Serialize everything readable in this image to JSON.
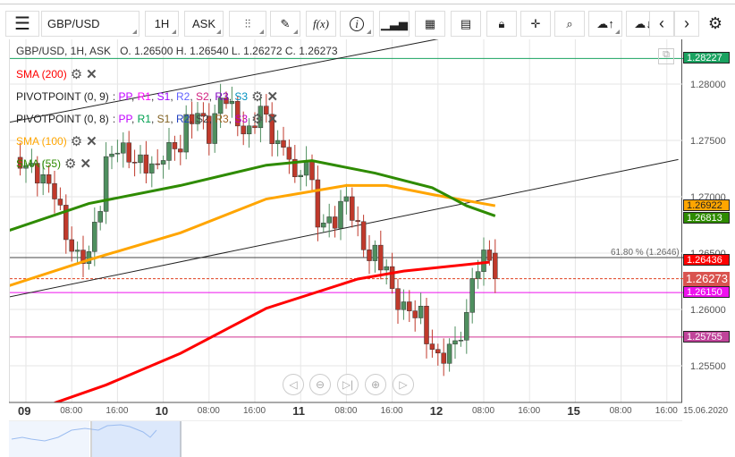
{
  "toolbar": {
    "symbol": "GBP/USD",
    "timeframe": "1H",
    "price_type": "ASK",
    "fx_label": "f(x)"
  },
  "info": {
    "header": "GBP/USD, 1H, ASK",
    "ohlc": "O. 1.26500 H. 1.26540 L. 1.26272 C. 1.26273"
  },
  "indicators": [
    {
      "label": "SMA (200)",
      "color": "#ff0000"
    },
    {
      "label": "PIVOTPOINT (0, 9)",
      "color": "#222",
      "levels": [
        {
          "t": "PP",
          "c": "#c000ff"
        },
        {
          "t": "R1",
          "c": "#ff00ff"
        },
        {
          "t": "S1",
          "c": "#a000ff"
        },
        {
          "t": "R2",
          "c": "#6060ff"
        },
        {
          "t": "S2",
          "c": "#d02080"
        },
        {
          "t": "R3",
          "c": "#8000c0"
        },
        {
          "t": "S3",
          "c": "#0090c0"
        }
      ]
    },
    {
      "label": "PIVOTPOINT (0, 8)",
      "color": "#222",
      "levels": [
        {
          "t": "PP",
          "c": "#c000ff"
        },
        {
          "t": "R1",
          "c": "#00a050"
        },
        {
          "t": "S1",
          "c": "#806020"
        },
        {
          "t": "R2",
          "c": "#2040c0"
        },
        {
          "t": "S2",
          "c": "#444"
        },
        {
          "t": "R3",
          "c": "#a06020"
        },
        {
          "t": "S3",
          "c": "#c000c0"
        }
      ]
    },
    {
      "label": "SMA (100)",
      "color": "#ffa500"
    },
    {
      "label": "SMA (55)",
      "color": "#2e8b00"
    }
  ],
  "price_tags": [
    {
      "value": "1.28227",
      "bg": "#1aa260",
      "price": 1.28227,
      "line": "#1aa260"
    },
    {
      "value": "1.26922",
      "bg": "#ffa500",
      "price": 1.26922,
      "text": "#222"
    },
    {
      "value": "1.26813",
      "bg": "#2e8b00",
      "price": 1.26813
    },
    {
      "value": "1.26436",
      "bg": "#ff0000",
      "price": 1.26436
    },
    {
      "value": "1.26273",
      "bg": "#d9534f",
      "price": 1.26273,
      "line": "#e04020",
      "dashed": true
    },
    {
      "value": "1.26150",
      "bg": "#ee11ee",
      "price": 1.2615,
      "line": "#ee11ee"
    },
    {
      "value": "1.25755",
      "bg": "#c0449a",
      "price": 1.25755,
      "line": "#d03090"
    }
  ],
  "fib": {
    "label": "61.80 % (1.2646)",
    "price": 1.2646
  },
  "chart_data": {
    "type": "candlestick",
    "yticks": [
      "1.28000",
      "1.27500",
      "1.27000",
      "1.26500",
      "1.26000",
      "1.25500"
    ],
    "ytick_values": [
      1.28,
      1.275,
      1.27,
      1.265,
      1.26,
      1.255
    ],
    "xdays": [
      {
        "label": "09",
        "h": 0
      },
      {
        "label": "10",
        "h": 24
      },
      {
        "label": "11",
        "h": 48
      },
      {
        "label": "12",
        "h": 72
      },
      {
        "label": "15",
        "h": 96
      }
    ],
    "xtimes": [
      {
        "label": "08:00",
        "h": 8
      },
      {
        "label": "16:00",
        "h": 16
      },
      {
        "label": "08:00",
        "h": 32
      },
      {
        "label": "16:00",
        "h": 40
      },
      {
        "label": "08:00",
        "h": 56
      },
      {
        "label": "16:00",
        "h": 64
      },
      {
        "label": "08:00",
        "h": 80
      },
      {
        "label": "16:00",
        "h": 88
      },
      {
        "label": "08:00",
        "h": 104
      },
      {
        "label": "16:00",
        "h": 112
      }
    ],
    "xdate": "15.06.2020",
    "close_keypoints": [
      [
        -2,
        1.2735
      ],
      [
        2,
        1.272
      ],
      [
        5,
        1.2705
      ],
      [
        7,
        1.2665
      ],
      [
        9,
        1.2645
      ],
      [
        11,
        1.265
      ],
      [
        13,
        1.2695
      ],
      [
        14,
        1.273
      ],
      [
        16,
        1.2745
      ],
      [
        18,
        1.2735
      ],
      [
        20,
        1.273
      ],
      [
        23,
        1.2725
      ],
      [
        24,
        1.274
      ],
      [
        27,
        1.2745
      ],
      [
        28,
        1.2765
      ],
      [
        30,
        1.2775
      ],
      [
        32,
        1.2755
      ],
      [
        34,
        1.2785
      ],
      [
        35,
        1.279
      ],
      [
        37,
        1.2765
      ],
      [
        39,
        1.2755
      ],
      [
        41,
        1.278
      ],
      [
        43,
        1.2755
      ],
      [
        44,
        1.2745
      ],
      [
        46,
        1.274
      ],
      [
        47,
        1.271
      ],
      [
        49,
        1.2735
      ],
      [
        51,
        1.268
      ],
      [
        52,
        1.2675
      ],
      [
        54,
        1.268
      ],
      [
        56,
        1.27
      ],
      [
        58,
        1.267
      ],
      [
        60,
        1.2645
      ],
      [
        61,
        1.265
      ],
      [
        63,
        1.2635
      ],
      [
        64,
        1.2615
      ],
      [
        66,
        1.26
      ],
      [
        67,
        1.26
      ],
      [
        69,
        1.2595
      ],
      [
        70,
        1.2575
      ],
      [
        72,
        1.2555
      ],
      [
        74,
        1.2565
      ],
      [
        75,
        1.257
      ],
      [
        77,
        1.259
      ],
      [
        78,
        1.263
      ],
      [
        80,
        1.2645
      ],
      [
        81,
        1.265
      ],
      [
        82,
        1.2627
      ]
    ],
    "sma55": [
      [
        -3,
        1.267
      ],
      [
        11,
        1.2694
      ],
      [
        27,
        1.271
      ],
      [
        42,
        1.2728
      ],
      [
        50,
        1.2732
      ],
      [
        61,
        1.2721
      ],
      [
        71,
        1.2708
      ],
      [
        77,
        1.2692
      ],
      [
        82,
        1.2683
      ]
    ],
    "sma100": [
      [
        -3,
        1.2621
      ],
      [
        11,
        1.2644
      ],
      [
        27,
        1.2668
      ],
      [
        42,
        1.2698
      ],
      [
        56,
        1.271
      ],
      [
        63,
        1.271
      ],
      [
        71,
        1.2702
      ],
      [
        82,
        1.2692
      ]
    ],
    "sma200": [
      [
        5,
        1.2517
      ],
      [
        14,
        1.2533
      ],
      [
        27,
        1.2561
      ],
      [
        42,
        1.2601
      ],
      [
        58,
        1.2627
      ],
      [
        66,
        1.2634
      ],
      [
        81,
        1.2642
      ]
    ],
    "trend_upper": [
      [
        -3,
        1.2766
      ],
      [
        72,
        1.284
      ]
    ],
    "trend_lower": [
      [
        -3,
        1.2611
      ],
      [
        114,
        1.2733
      ]
    ]
  }
}
